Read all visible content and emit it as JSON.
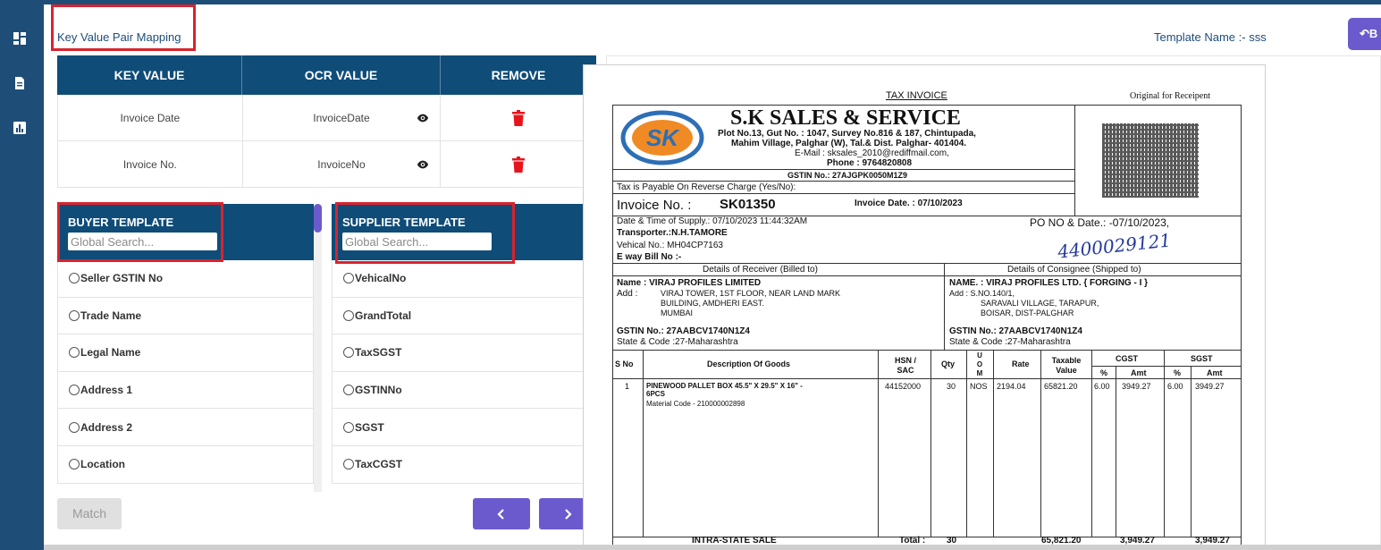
{
  "header": {
    "title": "Key Value Pair Mapping",
    "template_name": "Template Name :- sss",
    "back_button_label": "B"
  },
  "kv_table": {
    "columns": [
      "KEY VALUE",
      "OCR VALUE",
      "REMOVE"
    ],
    "rows": [
      {
        "key": "Invoice Date",
        "ocr": "InvoiceDate"
      },
      {
        "key": "Invoice No.",
        "ocr": "InvoiceNo"
      }
    ]
  },
  "buyer_template": {
    "title": "BUYER TEMPLATE",
    "search_placeholder": "Global Search...",
    "items": [
      "Seller GSTIN No",
      "Trade Name",
      "Legal Name",
      "Address 1",
      "Address 2",
      "Location"
    ]
  },
  "supplier_template": {
    "title": "SUPPLIER TEMPLATE",
    "search_placeholder": "Global Search...",
    "items": [
      "VehicalNo",
      "GrandTotal",
      "TaxSGST",
      "GSTINNo",
      "SGST",
      "TaxCGST"
    ]
  },
  "buttons": {
    "match": "Match"
  },
  "colors": {
    "sidebar": "#1e4d78",
    "table_header": "#0f4c78",
    "accent": "#6a5acd",
    "delete": "#e8141b",
    "highlight_box": "#d9232e"
  },
  "invoice": {
    "tax_invoice": "TAX INVOICE",
    "original": "Original for Receipent",
    "company": "S.K SALES & SERVICE",
    "addr1": "Plot No.13, Gut No. : 1047, Survey No.816 & 187, Chintupada,",
    "addr2": "Mahim Village, Palghar (W), Tal.& Dist. Palghar- 401404.",
    "email": "E-Mail : sksales_2010@rediffmail.com,",
    "phone": "Phone : 9764820808",
    "gstin": "GSTIN No.: 27AJGPK0050M1Z9",
    "reverse": "Tax is Payable On Reverse Charge (Yes/No):",
    "invoice_no_label": "Invoice No. :",
    "invoice_no": "SK01350",
    "invoice_date": "Invoice Date. : 07/10/2023",
    "supply": "Date & Time of Supply.: 07/10/2023 11:44:32AM",
    "po": "PO NO & Date.: -07/10/2023,",
    "transporter": "Transporter.:N.H.TAMORE",
    "vehical": "Vehical No.: MH04CP7163",
    "eway": "E way Bill No :-",
    "handwritten": "4400029121",
    "receiver_head": "Details of Receiver (Billed to)",
    "consignee_head": "Details of Consignee (Shipped to)",
    "r_name": "Name : VIRAJ PROFILES LIMITED",
    "r_add_label": "Add :",
    "r_add1": "VIRAJ TOWER, 1ST FLOOR, NEAR LAND MARK",
    "r_add2": "BUILDING, AMDHERI EAST.",
    "r_add3": "MUMBAI",
    "r_gstin": "GSTIN No.: 27AABCV1740N1Z4",
    "r_state": "State & Code :27-Maharashtra",
    "c_name": "NAME. : VIRAJ PROFILES LTD. { FORGING - I }",
    "c_add1": "Add : S.NO.140/1,",
    "c_add2": "SARAVALI VILLAGE, TARAPUR,",
    "c_add3": "BOISAR, DIST-PALGHAR",
    "c_gstin": "GSTIN No.: 27AABCV1740N1Z4",
    "c_state": "State & Code :27-Maharashtra",
    "cols": {
      "sno": "S No",
      "desc": "Description Of Goods",
      "hsn": "HSN / SAC",
      "qty": "Qty",
      "uom": "U O M",
      "rate": "Rate",
      "taxable": "Taxable Value",
      "cgst": "CGST",
      "sgst": "SGST",
      "pct": "%",
      "amt": "Amt"
    },
    "item": {
      "sno": "1",
      "desc1": "PINEWOOD PALLET BOX 45.5\" X 29.5\" X 16\" -",
      "desc2": "6PCS",
      "desc3": "Material Code - 210000002898",
      "hsn": "44152000",
      "qty": "30",
      "uom": "NOS",
      "rate": "2194.04",
      "taxable": "65821.20",
      "cgst_pct": "6.00",
      "cgst_amt": "3949.27",
      "sgst_pct": "6.00",
      "sgst_amt": "3949.27"
    },
    "footer": {
      "sale": "INTRA-STATE SALE",
      "total_label": "Total :",
      "qty": "30",
      "taxable": "65,821.20",
      "cgst": "3,949.27",
      "sgst": "3,949.27"
    }
  }
}
